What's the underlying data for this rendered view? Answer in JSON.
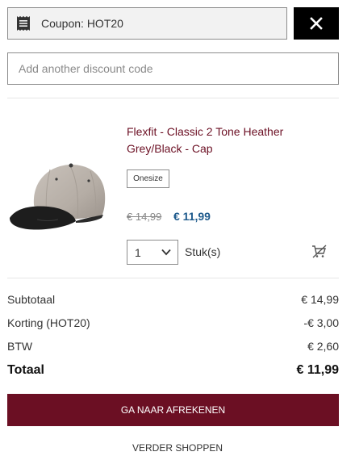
{
  "coupon": {
    "applied_label": "Coupon: HOT20",
    "icon": "receipt-icon",
    "remove_icon": "close-icon"
  },
  "discount": {
    "placeholder": "Add another discount code",
    "value": ""
  },
  "cart_item": {
    "title": "Flexfit - Classic 2 Tone Heather Grey/Black - Cap",
    "size": "Onesize",
    "price_old": "€ 14,99",
    "price_new": "€ 11,99",
    "quantity": "1",
    "unit": "Stuk(s)",
    "remove_icon": "cart-remove-icon"
  },
  "summary": {
    "subtotal_label": "Subtotaal",
    "subtotal_value": "€ 14,99",
    "discount_label": "Korting (HOT20)",
    "discount_value": "-€ 3,00",
    "tax_label": "BTW",
    "tax_value": "€ 2,60",
    "total_label": "Totaal",
    "total_value": "€ 11,99"
  },
  "actions": {
    "checkout_label": "GA NAAR AFREKENEN",
    "continue_label": "VERDER SHOPPEN"
  },
  "colors": {
    "brand": "#6b0f23",
    "price_new": "#1e5a8c",
    "coupon_bg": "#f2f2f2",
    "remove_bg": "#000000"
  }
}
